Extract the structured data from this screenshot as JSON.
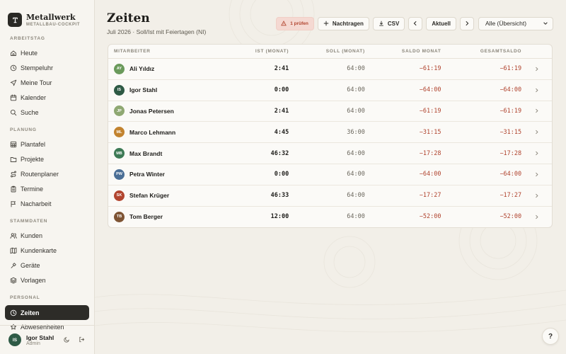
{
  "brand": {
    "name": "Metallwerk",
    "subtitle": "METALLBAU-COCKPIT",
    "logo_icon": "hammer-icon"
  },
  "sidebar": {
    "sections": [
      {
        "label": "ARBEITSTAG",
        "items": [
          {
            "label": "Heute",
            "icon": "home-icon"
          },
          {
            "label": "Stempeluhr",
            "icon": "clock-icon"
          },
          {
            "label": "Meine Tour",
            "icon": "navigation-icon"
          },
          {
            "label": "Kalender",
            "icon": "calendar-icon"
          },
          {
            "label": "Suche",
            "icon": "search-icon"
          }
        ]
      },
      {
        "label": "PLANUNG",
        "items": [
          {
            "label": "Plantafel",
            "icon": "grid-icon"
          },
          {
            "label": "Projekte",
            "icon": "folder-icon"
          },
          {
            "label": "Routenplaner",
            "icon": "route-icon"
          },
          {
            "label": "Termine",
            "icon": "clipboard-icon"
          },
          {
            "label": "Nacharbeit",
            "icon": "flag-icon"
          }
        ]
      },
      {
        "label": "STAMMDATEN",
        "items": [
          {
            "label": "Kunden",
            "icon": "users-icon"
          },
          {
            "label": "Kundenkarte",
            "icon": "map-icon"
          },
          {
            "label": "Geräte",
            "icon": "hammer-icon"
          },
          {
            "label": "Vorlagen",
            "icon": "layers-icon"
          }
        ]
      },
      {
        "label": "PERSONAL",
        "items": [
          {
            "label": "Zeiten",
            "icon": "clock-icon",
            "active": true
          },
          {
            "label": "Abwesenheiten",
            "icon": "star-icon"
          }
        ]
      }
    ]
  },
  "user": {
    "initials": "IS",
    "name": "Igor Stahl",
    "role": "Admin"
  },
  "page": {
    "title": "Zeiten",
    "subtitle": "Juli 2026 · Soll/Ist mit Feiertagen (NI)"
  },
  "toolbar": {
    "warning_label": "1 prüfen",
    "add_label": "Nachtragen",
    "csv_label": "CSV",
    "current_label": "Aktuell",
    "filter_value": "Alle (Übersicht)"
  },
  "table": {
    "headers": {
      "employee": "MITARBEITER",
      "ist": "IST (MONAT)",
      "soll": "SOLL (MONAT)",
      "saldo": "SALDO MONAT",
      "gesamt": "GESAMTSALDO"
    },
    "rows": [
      {
        "initials": "AY",
        "name": "Ali Yıldız",
        "color": "#6a9a5b",
        "ist": "2:41",
        "soll": "64:00",
        "saldo": "−61:19",
        "gesamt": "−61:19"
      },
      {
        "initials": "IS",
        "name": "Igor Stahl",
        "color": "#2e5a45",
        "ist": "0:00",
        "soll": "64:00",
        "saldo": "−64:00",
        "gesamt": "−64:00"
      },
      {
        "initials": "JP",
        "name": "Jonas Petersen",
        "color": "#8fa872",
        "ist": "2:41",
        "soll": "64:00",
        "saldo": "−61:19",
        "gesamt": "−61:19"
      },
      {
        "initials": "ML",
        "name": "Marco Lehmann",
        "color": "#c2832f",
        "ist": "4:45",
        "soll": "36:00",
        "saldo": "−31:15",
        "gesamt": "−31:15"
      },
      {
        "initials": "MB",
        "name": "Max Brandt",
        "color": "#3d7a55",
        "ist": "46:32",
        "soll": "64:00",
        "saldo": "−17:28",
        "gesamt": "−17:28"
      },
      {
        "initials": "PW",
        "name": "Petra Winter",
        "color": "#4b6f96",
        "ist": "0:00",
        "soll": "64:00",
        "saldo": "−64:00",
        "gesamt": "−64:00"
      },
      {
        "initials": "SK",
        "name": "Stefan Krüger",
        "color": "#b2452f",
        "ist": "46:33",
        "soll": "64:00",
        "saldo": "−17:27",
        "gesamt": "−17:27"
      },
      {
        "initials": "TB",
        "name": "Tom Berger",
        "color": "#7e5434",
        "ist": "12:00",
        "soll": "64:00",
        "saldo": "−52:00",
        "gesamt": "−52:00"
      }
    ]
  },
  "help_label": "?",
  "colors": {
    "accent_dark": "#2d2c28",
    "negative": "#b0432e",
    "warning_bg": "#f5d9d2"
  }
}
